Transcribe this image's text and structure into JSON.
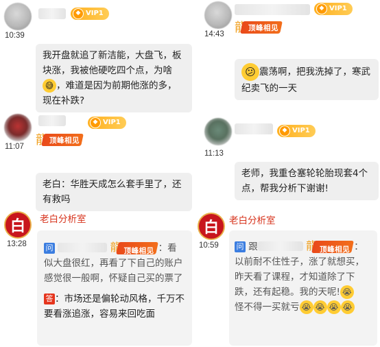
{
  "vip_label": "VIP1",
  "badge_label": "顶峰相见",
  "messages": {
    "left_1": {
      "time": "10:39",
      "text_a": "我开盘就追了新洁能，大盘飞，板块涨，我被他硬吃四个点，为啥",
      "text_b": "，难道是因为前期他涨的多，现在补跌?"
    },
    "left_2": {
      "time": "11:07",
      "text": "老白：华胜天成怎么套手里了，还有救吗"
    },
    "left_3": {
      "name": "老白分析室",
      "time": "13:28",
      "question_b": "：看似大盘很红，再看了下自己的账户感觉很一般啊，怀疑自己买的票了",
      "answer": "：市场还是偏轮动风格，千万不要看涨追涨，容易来回吃面",
      "q_tag": "问",
      "a_tag": "答"
    },
    "right_1": {
      "time": "14:43",
      "text_a": "震荡啊，把我洗掉了，寒武纪卖飞的一天"
    },
    "right_2": {
      "time": "11:13",
      "text": "老师，我重仓塞轮轮胎现套4个点，帮我分析下谢谢!"
    },
    "right_3": {
      "name": "老白分析室",
      "time": "10:59",
      "q_tag": "问",
      "question_a": "跟",
      "question_b": "：以前耐不住性子，涨了就想买，昨天看了课程，才知道除了下跌，还有起稳。我的天呢!",
      "question_c": "怪不得一买就亏"
    }
  },
  "icons": {
    "official_avatar_char": "白",
    "gem": "◆",
    "dragon": "龍"
  }
}
